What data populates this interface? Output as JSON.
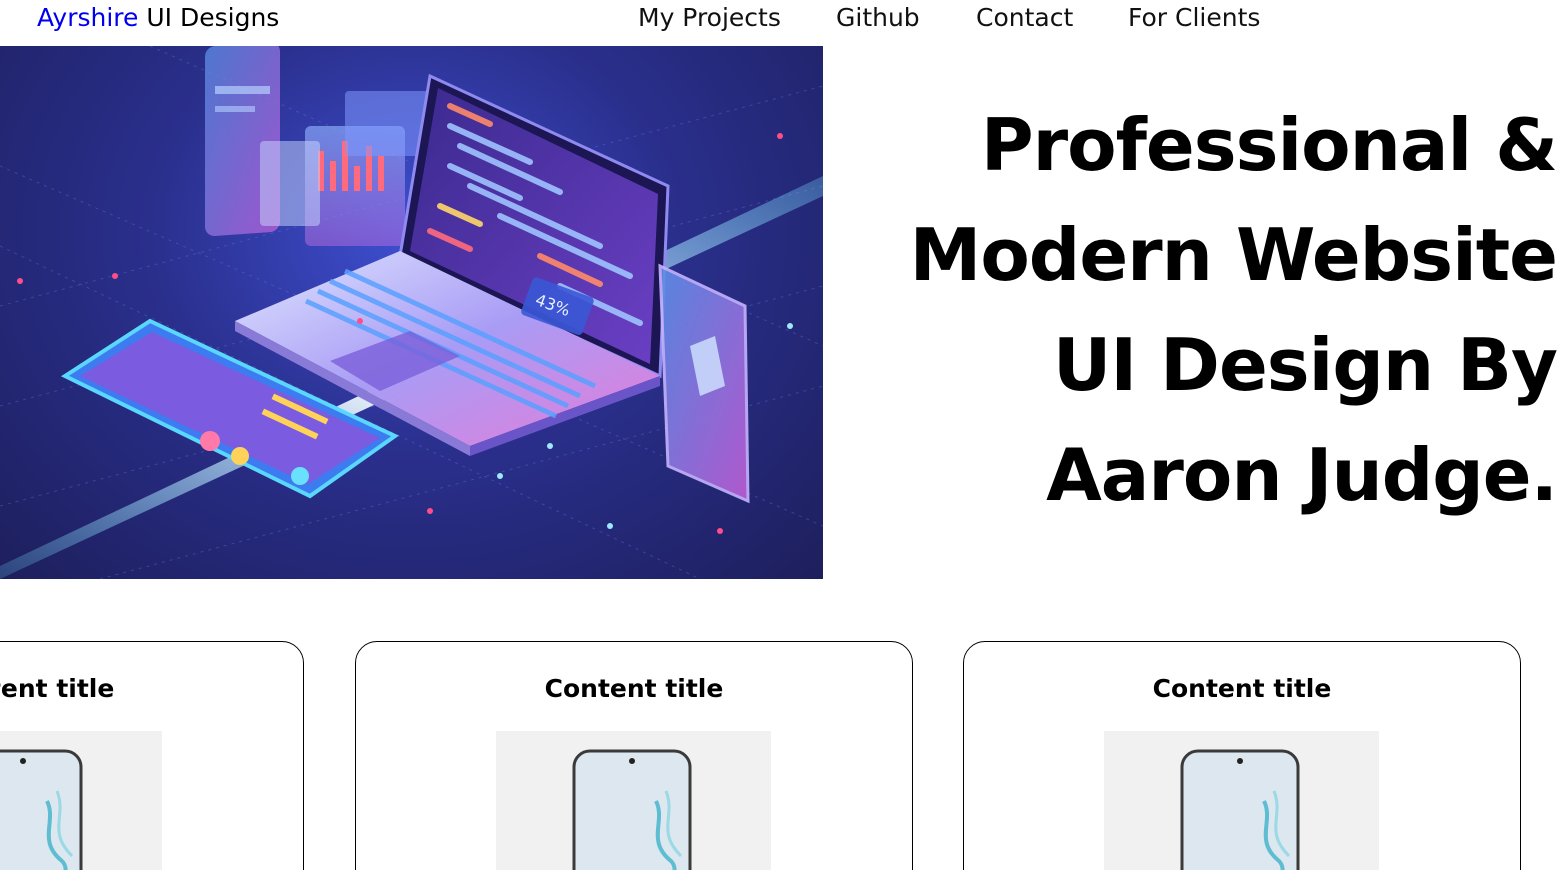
{
  "header": {
    "brand_accent": "Ayrshire",
    "brand_rest": " UI Designs",
    "nav": [
      {
        "label": "My Projects"
      },
      {
        "label": "Github"
      },
      {
        "label": "Contact"
      },
      {
        "label": "For Clients"
      }
    ]
  },
  "hero": {
    "title_lines": [
      "Professional &",
      "Modern Website",
      "UI Design By",
      "Aaron Judge."
    ],
    "illustration_badge": "43%"
  },
  "cards": [
    {
      "title": "Content title"
    },
    {
      "title": "Content title"
    },
    {
      "title": "Content title"
    }
  ],
  "colors": {
    "brand_accent": "#0000ee",
    "hero_background": "#2a2f8c",
    "card_thumb_background": "#f1f1f1"
  }
}
